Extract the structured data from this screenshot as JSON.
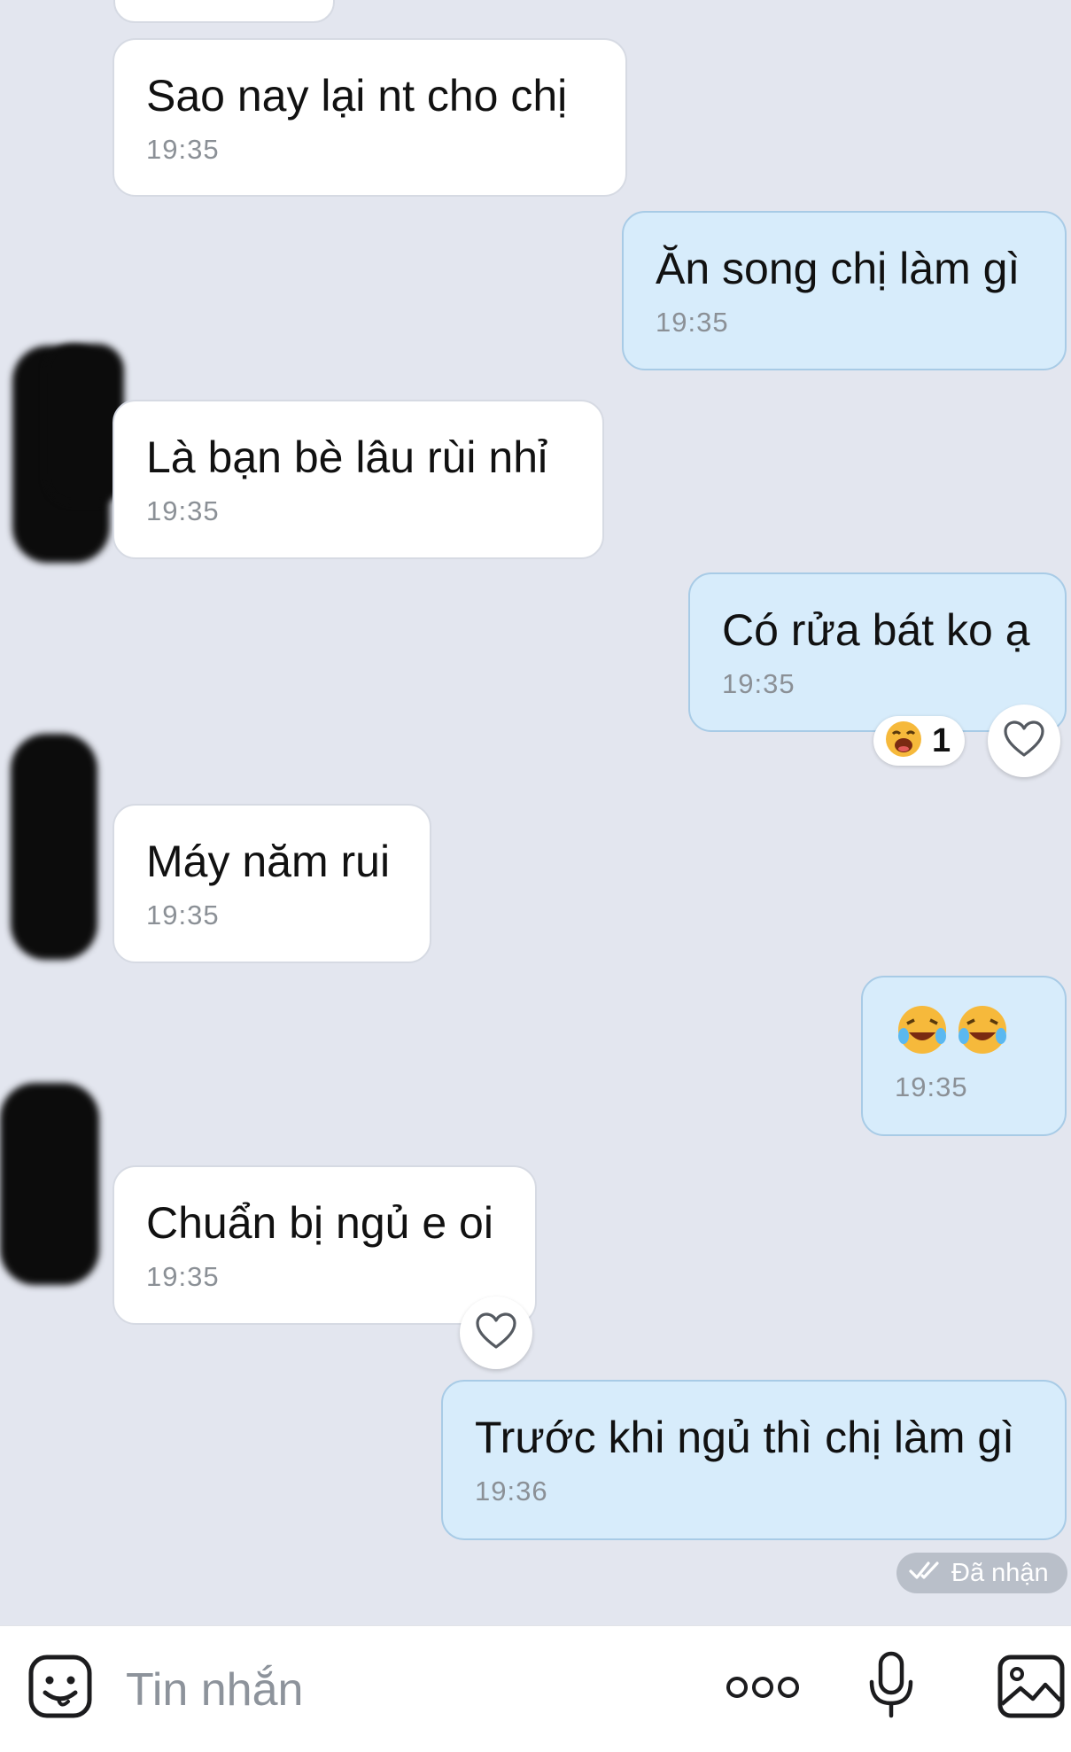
{
  "messages": [
    {
      "id": "m0",
      "direction": "in",
      "text": "",
      "time": ""
    },
    {
      "id": "m1",
      "direction": "in",
      "text": "Sao nay lại nt cho chị",
      "time": "19:35"
    },
    {
      "id": "m2",
      "direction": "out",
      "text": "Ăn song chị làm gì",
      "time": "19:35"
    },
    {
      "id": "m3",
      "direction": "in",
      "text": "Là bạn bè lâu rùi nhỉ",
      "time": "19:35"
    },
    {
      "id": "m4",
      "direction": "out",
      "text": "Có rửa bát ko ạ",
      "time": "19:35",
      "reaction": {
        "emoji": "laughing-face",
        "count": "1"
      }
    },
    {
      "id": "m5",
      "direction": "in",
      "text": "Máy năm rui",
      "time": "19:35"
    },
    {
      "id": "m6",
      "direction": "out",
      "text": "🤣🤣",
      "time": "19:35"
    },
    {
      "id": "m7",
      "direction": "in",
      "text": "Chuẩn bị ngủ e oi",
      "time": "19:35"
    },
    {
      "id": "m8",
      "direction": "out",
      "text": "Trước khi ngủ thì chị làm gì",
      "time": "19:36"
    }
  ],
  "status": {
    "label": "Đã nhận",
    "icon": "double-check-icon"
  },
  "composer": {
    "placeholder": "Tin nhắn",
    "icons": [
      "sticker-icon",
      "more-icon",
      "microphone-icon",
      "image-icon"
    ]
  },
  "colors": {
    "background": "#e3e6ef",
    "incoming_bubble": "#ffffff",
    "outgoing_bubble": "#d7ecfb",
    "outgoing_border": "#a8cbe6",
    "time_text": "#8b9096"
  }
}
